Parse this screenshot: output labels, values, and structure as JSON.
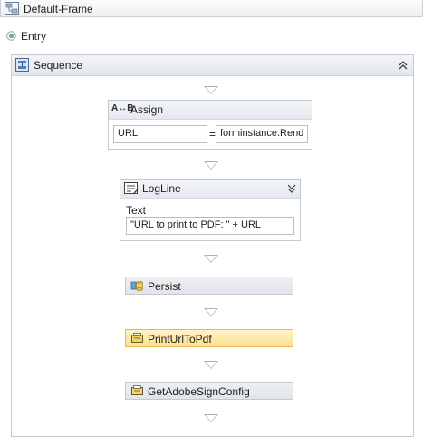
{
  "frame": {
    "title": "Default-Frame"
  },
  "entry": {
    "label": "Entry"
  },
  "sequence": {
    "label": "Sequence",
    "assign": {
      "label": "Assign",
      "to": "URL",
      "equals": "=",
      "value": "forminstance.Rend"
    },
    "logline": {
      "label": "LogLine",
      "text_label": "Text",
      "text_value": "\"URL to print to PDF: \" + URL"
    },
    "activities": [
      {
        "label": "Persist"
      },
      {
        "label": "PrintUrlToPdf",
        "selected": true
      },
      {
        "label": "GetAdobeSignConfig"
      }
    ]
  },
  "colors": {
    "selected_fill": "#fde08f",
    "header_fill": "#e5e9ee",
    "border": "#c3c9d1",
    "drop_arrow": "#a9b2bf"
  }
}
